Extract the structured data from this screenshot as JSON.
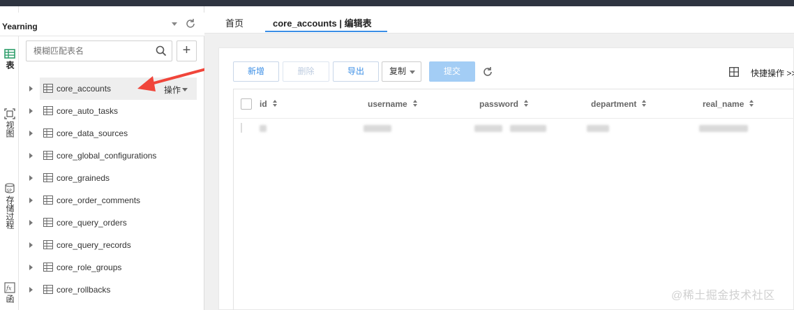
{
  "header": {
    "database_name": "Yearning"
  },
  "rail": {
    "items": [
      {
        "label": "表",
        "icon": "table-grid-icon",
        "active": true
      },
      {
        "label": "视图",
        "icon": "view-icon",
        "active": false
      },
      {
        "label": "存储过程",
        "icon": "stored-procedure-icon",
        "active": false
      },
      {
        "label": "函",
        "icon": "function-icon",
        "active": false
      }
    ]
  },
  "search": {
    "placeholder": "模糊匹配表名"
  },
  "tree": {
    "row_action_label": "操作",
    "items": [
      {
        "label": "core_accounts",
        "selected": true
      },
      {
        "label": "core_auto_tasks"
      },
      {
        "label": "core_data_sources"
      },
      {
        "label": "core_global_configurations"
      },
      {
        "label": "core_graineds"
      },
      {
        "label": "core_order_comments"
      },
      {
        "label": "core_query_orders"
      },
      {
        "label": "core_query_records"
      },
      {
        "label": "core_role_groups"
      },
      {
        "label": "core_rollbacks"
      }
    ]
  },
  "tabs": [
    {
      "label": "首页",
      "active": false
    },
    {
      "label": "core_accounts | 编辑表",
      "active": true
    }
  ],
  "toolbar": {
    "add_label": "新增",
    "delete_label": "删除",
    "export_label": "导出",
    "copy_label": "复制",
    "submit_label": "提交",
    "quick_ops_label": "快捷操作 >>"
  },
  "table": {
    "columns": [
      "id",
      "username",
      "password",
      "department",
      "real_name"
    ]
  },
  "watermark": "@稀土掘金技术社区",
  "colors": {
    "accent": "#3a8ee6",
    "annotation_arrow": "#f0453a",
    "submit_disabled": "#a3cdf5"
  }
}
